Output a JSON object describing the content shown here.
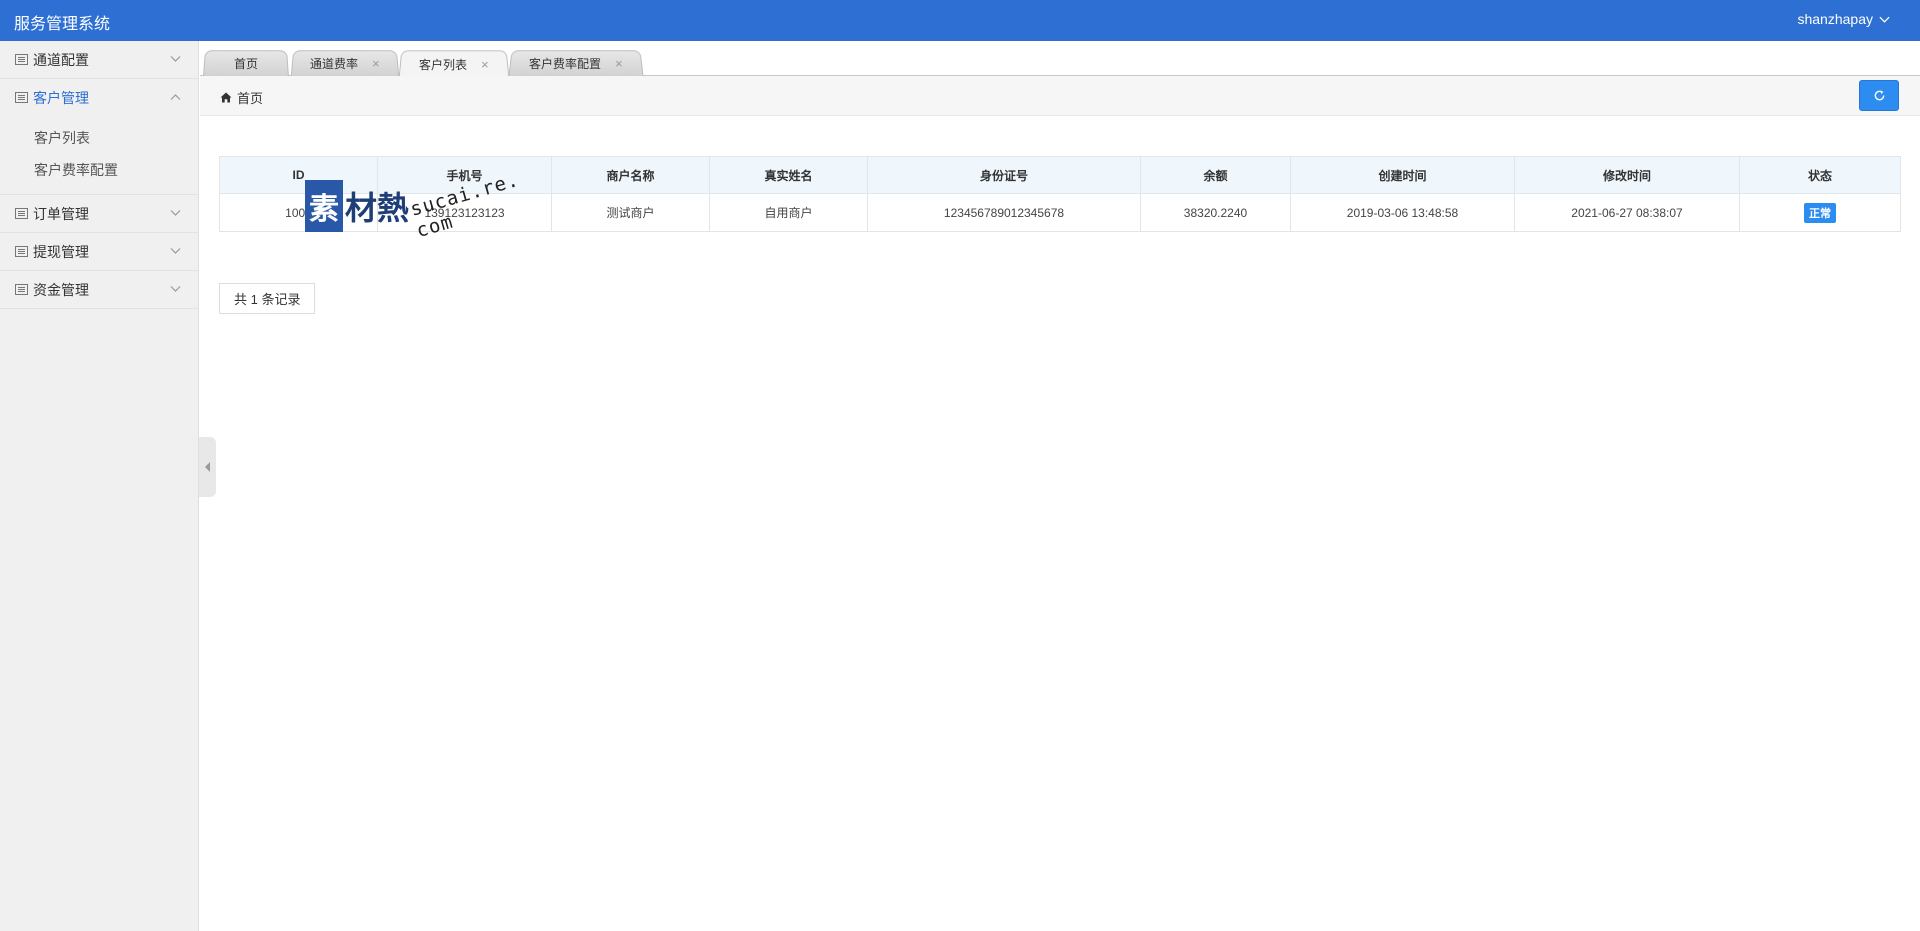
{
  "header": {
    "app_title": "服务管理系统",
    "username": "shanzhapay"
  },
  "sidebar": {
    "groups": [
      {
        "label": "通道配置",
        "expanded": false
      },
      {
        "label": "客户管理",
        "expanded": true,
        "children": [
          "客户列表",
          "客户费率配置"
        ]
      },
      {
        "label": "订单管理",
        "expanded": false
      },
      {
        "label": "提现管理",
        "expanded": false
      },
      {
        "label": "资金管理",
        "expanded": false
      }
    ]
  },
  "tabs": [
    {
      "label": "首页",
      "closable": false
    },
    {
      "label": "通道费率",
      "closable": true
    },
    {
      "label": "客户列表",
      "closable": true,
      "active": true
    },
    {
      "label": "客户费率配置",
      "closable": true
    }
  ],
  "tab_close_glyph": "×",
  "breadcrumb": {
    "home": "首页"
  },
  "table": {
    "columns": [
      "ID",
      "手机号",
      "商户名称",
      "真实姓名",
      "身份证号",
      "余额",
      "创建时间",
      "修改时间",
      "状态"
    ],
    "rows": [
      [
        "1001",
        "139123123123",
        "测试商户",
        "自用商户",
        "123456789012345678",
        "38320.2240",
        "2019-03-06 13:48:58",
        "2021-06-27 08:38:07",
        "正常"
      ]
    ]
  },
  "pager": {
    "summary": "共 1 条记录"
  },
  "watermark": {
    "seal_char": "素",
    "text": "材熱",
    "domain": "sucai.re. com"
  },
  "colors": {
    "header": "#2d6fd2",
    "accent": "#2d8cf0",
    "sidebar_bg": "#f0f0f0",
    "table_head": "#eff7fd"
  },
  "icons": {
    "user_menu": "chevron-down-icon",
    "menu_group": "list-icon",
    "breadcrumb": "home-icon",
    "refresh": "refresh-icon",
    "collapse": "caret-left-icon"
  }
}
